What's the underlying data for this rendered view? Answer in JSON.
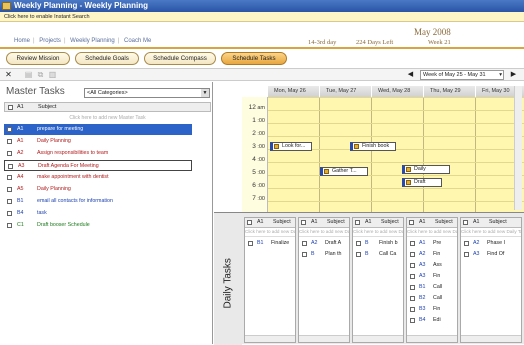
{
  "window": {
    "title": "Weekly Planning - Weekly Planning"
  },
  "infobar": {
    "text": "Click here to enable Instant Search"
  },
  "nav": {
    "items": [
      "Home",
      "Projects",
      "Weekly Planning",
      "Coach Me"
    ]
  },
  "header": {
    "week_label": "14-3rd day",
    "days_left": "224 Days Left",
    "month_year": "May 2008",
    "week_no": "Week 21",
    "brand_we": "We",
    "brand_num": "21"
  },
  "tabs": [
    "Review Mission",
    "Schedule Goals",
    "Schedule Compass",
    "Schedule Tasks"
  ],
  "toolbar": {
    "week_combo": "Week of May 25 - May 31"
  },
  "master": {
    "title": "Master Tasks",
    "category": "<All Categories>",
    "col_pr": "A1",
    "col_subject": "Subject",
    "add_hint": "Click here to add new Master Task",
    "tasks": [
      {
        "pr": "A1",
        "subject": "prepare for meeting",
        "color": "#1a3fb0"
      },
      {
        "pr": "A1",
        "subject": "Daily Planning",
        "color": "#b01a1a"
      },
      {
        "pr": "A2",
        "subject": "Assign responsibilities to team",
        "color": "#b01a1a"
      },
      {
        "pr": "A3",
        "subject": "Draft Agenda For Meeting",
        "color": "#b01a1a"
      },
      {
        "pr": "A4",
        "subject": "make appointment with dentist",
        "color": "#b01a1a"
      },
      {
        "pr": "A5",
        "subject": "Daily Planning",
        "color": "#b01a1a"
      },
      {
        "pr": "B1",
        "subject": "email all contacts for information",
        "color": "#1a3fb0"
      },
      {
        "pr": "B4",
        "subject": "task",
        "color": "#1a3fb0"
      },
      {
        "pr": "C1",
        "subject": "Draft booser Schedule",
        "color": "#1a7a1a"
      }
    ]
  },
  "calendar": {
    "days": [
      "Sun, May 25",
      "Mon, May 26",
      "Tue, May 27",
      "Wed, May 28",
      "Thu, May 29",
      "Fri, May 30"
    ],
    "times": [
      {
        "n": "12",
        "s": "am"
      },
      {
        "n": "1",
        "s": ":00"
      },
      {
        "n": "2",
        "s": ":00"
      },
      {
        "n": "3",
        "s": ":00"
      },
      {
        "n": "4",
        "s": ":00"
      },
      {
        "n": "5",
        "s": ":00"
      },
      {
        "n": "6",
        "s": ":00"
      },
      {
        "n": "7",
        "s": ":00"
      }
    ],
    "appointments": [
      {
        "label": "Look for..."
      },
      {
        "label": "Gather T..."
      },
      {
        "label": "Finish book"
      },
      {
        "label": "Daily"
      },
      {
        "label": "Draft"
      }
    ]
  },
  "daily": {
    "label": "Daily Tasks",
    "col_pr": "A1",
    "col_subject": "Subject",
    "add_hint": "Click here to add new Daily Task",
    "columns": [
      {
        "rows": [
          {
            "pr": "B1",
            "subject": "Finalize"
          }
        ]
      },
      {
        "rows": [
          {
            "pr": "A2",
            "subject": "Draft A"
          },
          {
            "pr": "B",
            "subject": "Plan th"
          }
        ]
      },
      {
        "rows": [
          {
            "pr": "B",
            "subject": "Finish b"
          },
          {
            "pr": "B",
            "subject": "Call Ca"
          }
        ]
      },
      {
        "rows": [
          {
            "pr": "A1",
            "subject": "Pre"
          },
          {
            "pr": "A2",
            "subject": "Fin"
          },
          {
            "pr": "A3",
            "subject": "Ass"
          },
          {
            "pr": "A3",
            "subject": "Fin"
          },
          {
            "pr": "B1",
            "subject": "Call"
          },
          {
            "pr": "B2",
            "subject": "Call"
          },
          {
            "pr": "B3",
            "subject": "Fin"
          },
          {
            "pr": "B4",
            "subject": "Edi"
          }
        ]
      },
      {
        "rows": [
          {
            "pr": "A2",
            "subject": "Phase I"
          },
          {
            "pr": "A3",
            "subject": "Find Of"
          }
        ]
      }
    ]
  }
}
